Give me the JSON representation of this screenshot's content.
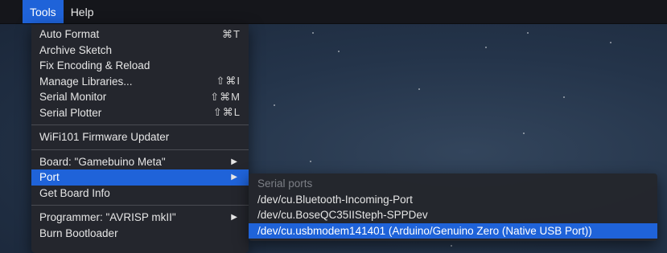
{
  "menubar": {
    "items": [
      {
        "label": "Tools",
        "active": true
      },
      {
        "label": "Help",
        "active": false
      }
    ]
  },
  "tools_menu": {
    "group1": [
      {
        "label": "Auto Format",
        "shortcut": "⌘T"
      },
      {
        "label": "Archive Sketch",
        "shortcut": ""
      },
      {
        "label": "Fix Encoding & Reload",
        "shortcut": ""
      },
      {
        "label": "Manage Libraries...",
        "shortcut": "⇧⌘I"
      },
      {
        "label": "Serial Monitor",
        "shortcut": "⇧⌘M"
      },
      {
        "label": "Serial Plotter",
        "shortcut": "⇧⌘L"
      }
    ],
    "group2": [
      {
        "label": "WiFi101 Firmware Updater"
      }
    ],
    "group3": [
      {
        "label": "Board: \"Gamebuino Meta\"",
        "submenu": true
      },
      {
        "label": "Port",
        "submenu": true,
        "highlighted": true
      },
      {
        "label": "Get Board Info",
        "submenu": false
      }
    ],
    "group4": [
      {
        "label": "Programmer: \"AVRISP mkII\"",
        "submenu": true
      },
      {
        "label": "Burn Bootloader",
        "submenu": false
      }
    ]
  },
  "port_submenu": {
    "header": "Serial ports",
    "items": [
      {
        "label": "/dev/cu.Bluetooth-Incoming-Port",
        "selected": false
      },
      {
        "label": "/dev/cu.BoseQC35IISteph-SPPDev",
        "selected": false
      },
      {
        "label": "/dev/cu.usbmodem141401 (Arduino/Genuino Zero (Native USB Port))",
        "selected": true
      }
    ]
  },
  "colors": {
    "highlight": "#1f63d9",
    "menu_bg": "#24262c",
    "background": "#24344a"
  },
  "icons": {
    "submenu_arrow": "▶"
  }
}
